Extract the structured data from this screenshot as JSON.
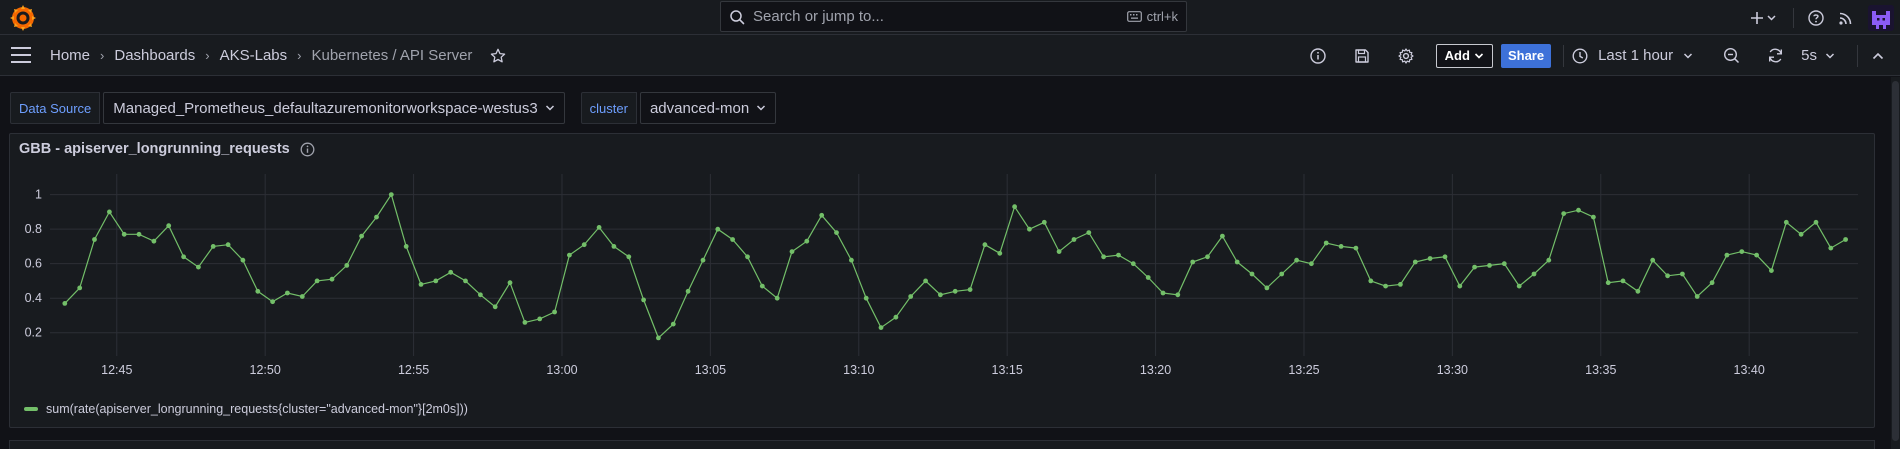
{
  "search": {
    "placeholder": "Search or jump to...",
    "shortcut": "ctrl+k"
  },
  "breadcrumb": [
    "Home",
    "Dashboards",
    "AKS-Labs",
    "Kubernetes / API Server"
  ],
  "toolbar": {
    "add_label": "Add",
    "share_label": "Share",
    "time_range": "Last 1 hour",
    "refresh_interval": "5s"
  },
  "variables": [
    {
      "label": "Data Source",
      "value": "Managed_Prometheus_defaultazuremonitorworkspace-westus3"
    },
    {
      "label": "cluster",
      "value": "advanced-mon"
    }
  ],
  "panel": {
    "title": "GBB - apiserver_longrunning_requests"
  },
  "colors": {
    "series": "#73bf69",
    "accent": "#3d71d9",
    "background": "#111217",
    "panel": "#181b1f"
  },
  "chart_data": {
    "type": "line",
    "title": "GBB - apiserver_longrunning_requests",
    "xlabel": "",
    "ylabel": "",
    "x_ticks": [
      "12:45",
      "12:50",
      "12:55",
      "13:00",
      "13:05",
      "13:10",
      "13:15",
      "13:20",
      "13:25",
      "13:30",
      "13:35",
      "13:40"
    ],
    "y_ticks": [
      0.2,
      0.4,
      0.6,
      0.8,
      1
    ],
    "ylim": [
      0.1,
      1.05
    ],
    "x_start": "12:43:15",
    "x_step_seconds": 30,
    "grid": true,
    "legend_position": "bottom-left",
    "series": [
      {
        "name": "sum(rate(apiserver_longrunning_requests{cluster=\"advanced-mon\"}[2m0s]))",
        "values": [
          0.37,
          0.46,
          0.74,
          0.9,
          0.77,
          0.77,
          0.73,
          0.82,
          0.64,
          0.58,
          0.7,
          0.71,
          0.62,
          0.44,
          0.38,
          0.43,
          0.41,
          0.5,
          0.51,
          0.59,
          0.76,
          0.87,
          1.0,
          0.7,
          0.48,
          0.5,
          0.55,
          0.5,
          0.42,
          0.35,
          0.49,
          0.26,
          0.28,
          0.32,
          0.65,
          0.71,
          0.81,
          0.7,
          0.64,
          0.39,
          0.17,
          0.25,
          0.44,
          0.62,
          0.8,
          0.74,
          0.64,
          0.47,
          0.4,
          0.67,
          0.73,
          0.88,
          0.78,
          0.62,
          0.4,
          0.23,
          0.29,
          0.41,
          0.5,
          0.42,
          0.44,
          0.45,
          0.71,
          0.66,
          0.93,
          0.8,
          0.84,
          0.67,
          0.74,
          0.78,
          0.64,
          0.65,
          0.6,
          0.52,
          0.43,
          0.42,
          0.61,
          0.64,
          0.76,
          0.61,
          0.54,
          0.46,
          0.54,
          0.62,
          0.6,
          0.72,
          0.7,
          0.69,
          0.5,
          0.47,
          0.48,
          0.61,
          0.63,
          0.64,
          0.47,
          0.58,
          0.59,
          0.6,
          0.47,
          0.54,
          0.62,
          0.89,
          0.91,
          0.87,
          0.49,
          0.5,
          0.44,
          0.62,
          0.53,
          0.54,
          0.41,
          0.49,
          0.65,
          0.67,
          0.65,
          0.56,
          0.84,
          0.77,
          0.84,
          0.69,
          0.74
        ]
      }
    ]
  }
}
